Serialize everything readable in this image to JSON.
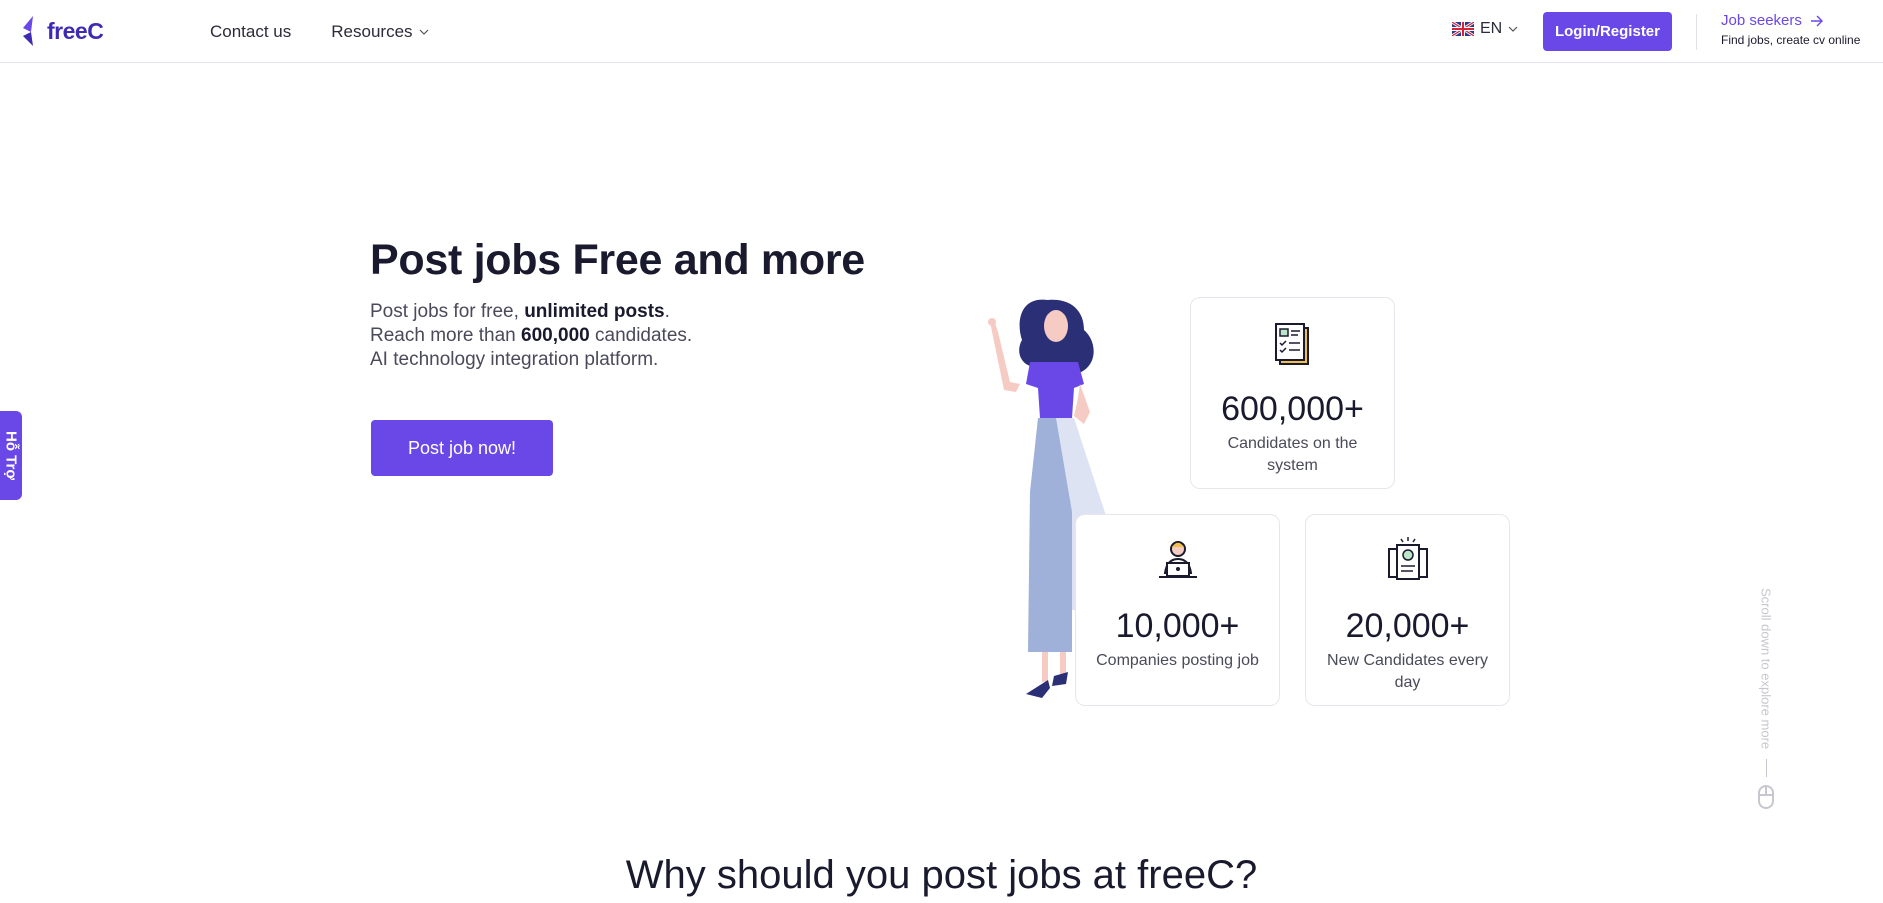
{
  "header": {
    "logo_text": "freeC",
    "nav": [
      {
        "label": "Contact us"
      },
      {
        "label": "Resources"
      }
    ],
    "language": "EN",
    "login_label": "Login/Register",
    "job_seekers": {
      "title": "Job seekers",
      "subtitle": "Find jobs, create cv online"
    }
  },
  "support_tab": "Hỗ Trợ",
  "hero": {
    "title": "Post jobs Free and more",
    "line1_pre": "Post jobs for free, ",
    "line1_strong": "unlimited posts",
    "line1_post": ".",
    "line2_pre": "Reach more than ",
    "line2_strong": "600,000",
    "line2_post": " candidates.",
    "line3": "AI technology integration platform.",
    "cta": "Post job now!"
  },
  "stats": [
    {
      "value": "600,000+",
      "label": "Candidates on the system",
      "icon": "document-list-icon"
    },
    {
      "value": "10,000+",
      "label": "Companies posting job",
      "icon": "person-laptop-icon"
    },
    {
      "value": "20,000+",
      "label": "New Candidates every day",
      "icon": "id-card-icon"
    }
  ],
  "scroll_hint": "Scroll down to explore more",
  "section_title": "Why should you post jobs at freeC?",
  "colors": {
    "accent": "#6a48e8",
    "text": "#1a1a2e"
  }
}
